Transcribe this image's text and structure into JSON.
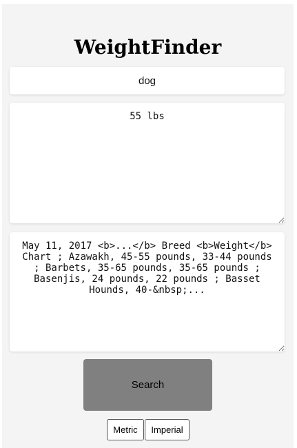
{
  "app": {
    "title": "WeightFinder"
  },
  "search": {
    "value": "dog"
  },
  "result": {
    "value": "55 lbs"
  },
  "snippet": {
    "value": "May 11, 2017 <b>...</b> Breed <b>Weight</b> Chart ; Azawakh, 45-55 pounds, 33-44 pounds ; Barbets, 35-65 pounds, 35-65 pounds ; Basenjis, 24 pounds, 22 pounds ; Basset Hounds, 40-&nbsp;..."
  },
  "actions": {
    "search_label": "Search",
    "metric_label": "Metric",
    "imperial_label": "Imperial"
  },
  "colors": {
    "panel_bg": "#f4f4f4",
    "search_button_bg": "#808080"
  }
}
